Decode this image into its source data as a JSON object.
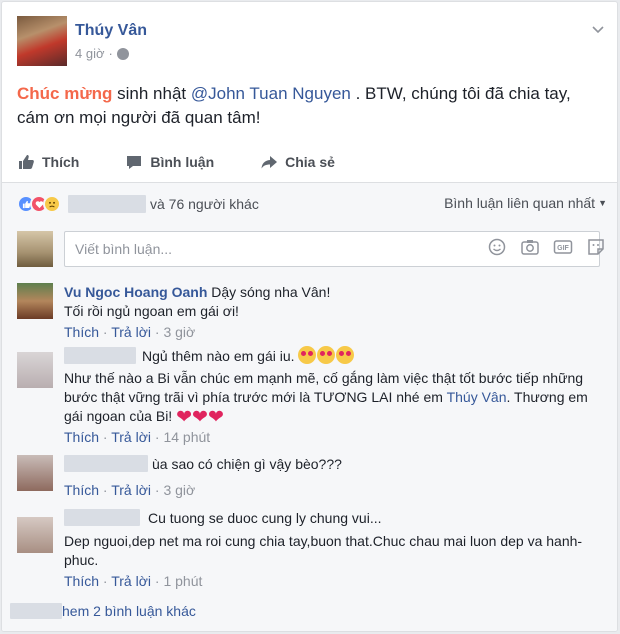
{
  "post": {
    "author": "Thúy Vân",
    "time": "4 giờ",
    "text_highlight": "Chúc mừng",
    "text_part1": " sinh nhật ",
    "mention": "@John Tuan Nguyen",
    "text_part2": " . BTW, chúng tôi đã chia tay, cám ơn mọi người đã quan tâm!"
  },
  "actions": {
    "like": "Thích",
    "comment": "Bình luận",
    "share": "Chia sẻ"
  },
  "reactions": {
    "others_text": "và 76 người khác",
    "sort_label": "Bình luận liên quan nhất"
  },
  "comment_input": {
    "placeholder": "Viết bình luận..."
  },
  "comments": [
    {
      "name": "Vu Ngoc Hoang Oanh",
      "text_line1": " Dậy sóng nha Vân!",
      "text_line2": "Tối rồi ngủ ngoan em gái ơi!",
      "like": "Thích",
      "reply": "Trả lời",
      "time": "3 giờ"
    },
    {
      "text_line1": "Ngủ thêm nào em gái iu.",
      "text_line2": "Như thế nào a Bi vẫn chúc em mạnh mẽ, cố gắng làm việc thật tốt bước tiếp những bước thật vững trãi vì phía trước mới là TƯƠNG LAI nhé em ",
      "mention": "Thúy Vân",
      "text_line3": ". Thương em gái ngoan của Bi!",
      "like": "Thích",
      "reply": "Trả lời",
      "time": "14 phút"
    },
    {
      "text_line1": "ùa sao có chiện gì vậy bèo???",
      "like": "Thích",
      "reply": "Trả lời",
      "time": "3 giờ"
    },
    {
      "text_line1": "Cu tuong se duoc cung ly chung vui...",
      "text_line2": "Dep nguoi,dep net ma roi cung chia tay,buon that.Chuc chau mai luon dep va hanh-phuc.",
      "like": "Thích",
      "reply": "Trả lời",
      "time": "1 phút"
    }
  ],
  "more_comments": "hem 2 bình luận khác",
  "colors": {
    "link": "#365899",
    "highlight": "#f4684b",
    "meta": "#90949c"
  }
}
